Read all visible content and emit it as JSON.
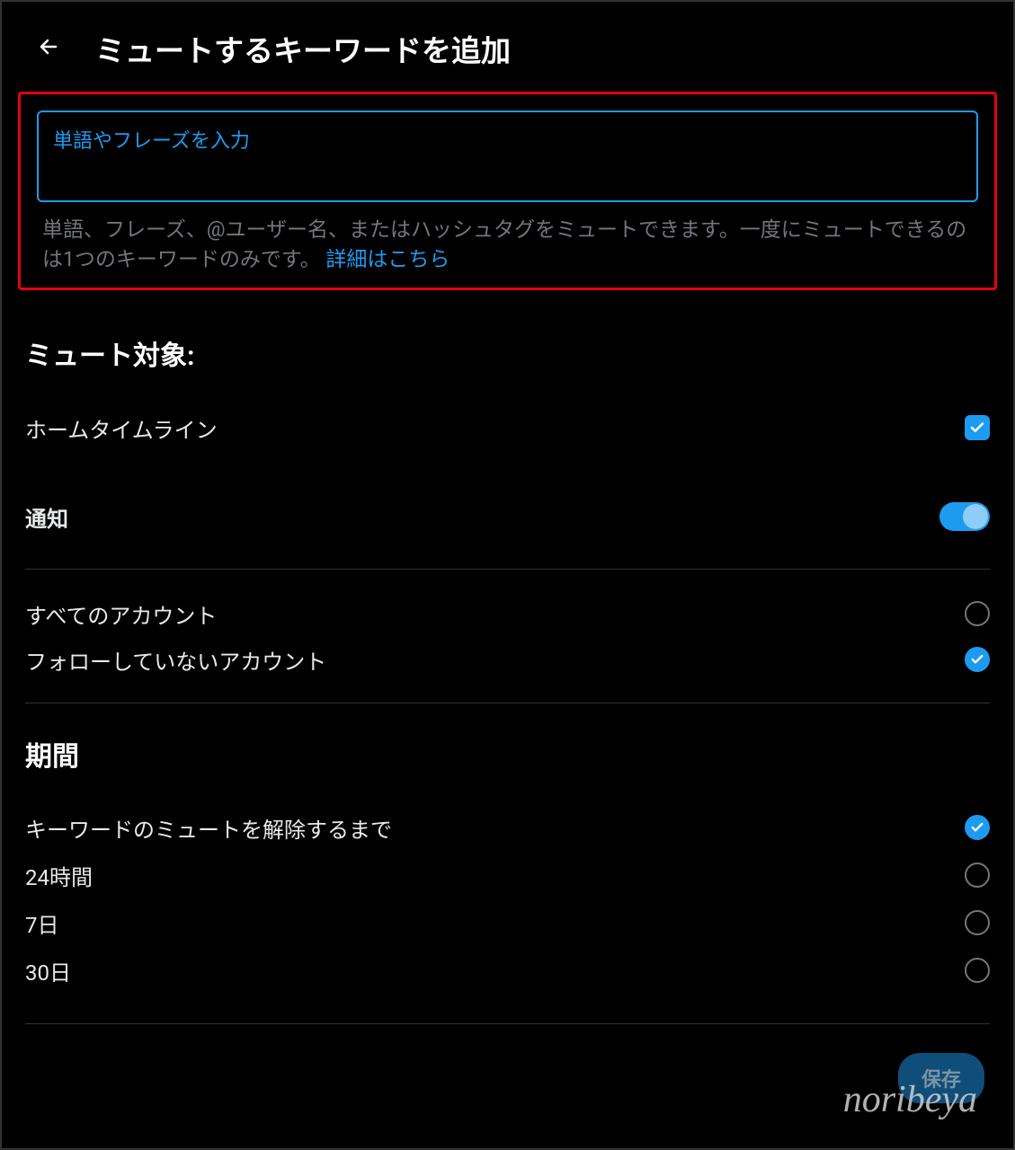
{
  "header": {
    "title": "ミュートするキーワードを追加"
  },
  "input": {
    "placeholder_label": "単語やフレーズを入力",
    "help_text": "単語、フレーズ、@ユーザー名、またはハッシュタグをミュートできます。一度にミュートできるのは1つのキーワードのみです。",
    "help_link": "詳細はこちら"
  },
  "mute_target": {
    "title": "ミュート対象:",
    "home_timeline": "ホームタイムライン",
    "notifications": "通知",
    "accounts": {
      "all": "すべてのアカウント",
      "not_following": "フォローしていないアカウント"
    }
  },
  "duration": {
    "title": "期間",
    "options": {
      "until_unmute": "キーワードのミュートを解除するまで",
      "h24": "24時間",
      "d7": "7日",
      "d30": "30日"
    }
  },
  "actions": {
    "save": "保存"
  },
  "watermark": "noribeya"
}
